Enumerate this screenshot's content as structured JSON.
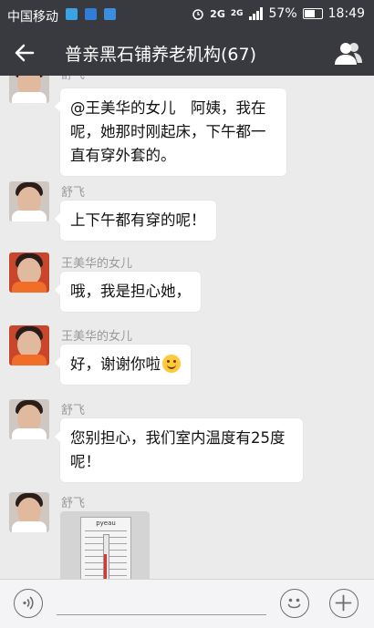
{
  "status_bar": {
    "carrier": "中国移动",
    "network_1": "2G",
    "network_2": "2G",
    "battery": "57%",
    "time": "18:49"
  },
  "header": {
    "title": "普亲黑石铺养老机构(67)"
  },
  "messages": [
    {
      "sender": "舒飞",
      "text": "@王美华的女儿　阿姨，我在呢，她那时刚起床，下午都一直有穿外套的。",
      "avatar": "child-white"
    },
    {
      "sender": "舒飞",
      "text": "上下午都有穿的呢！",
      "avatar": "child-white"
    },
    {
      "sender": "王美华的女儿",
      "text": "哦，我是担心她，",
      "avatar": "child-red"
    },
    {
      "sender": "王美华的女儿",
      "text": "好，谢谢你啦",
      "emoji": "smile-emoji",
      "avatar": "child-red"
    },
    {
      "sender": "舒飞",
      "text": "您别担心，我们室内温度有25度呢！",
      "avatar": "child-white"
    },
    {
      "sender": "舒飞",
      "image": "thermometer-photo",
      "photo_brand": "pyeau",
      "avatar": "child-white"
    }
  ],
  "input_bar": {
    "voice_icon": "voice-icon",
    "emoji_icon": "emoji-icon",
    "plus_icon": "plus-icon"
  },
  "colors": {
    "bar": "#393a3f",
    "chat_bg": "#ebebeb",
    "bubble": "#ffffff",
    "sender": "#999999"
  }
}
